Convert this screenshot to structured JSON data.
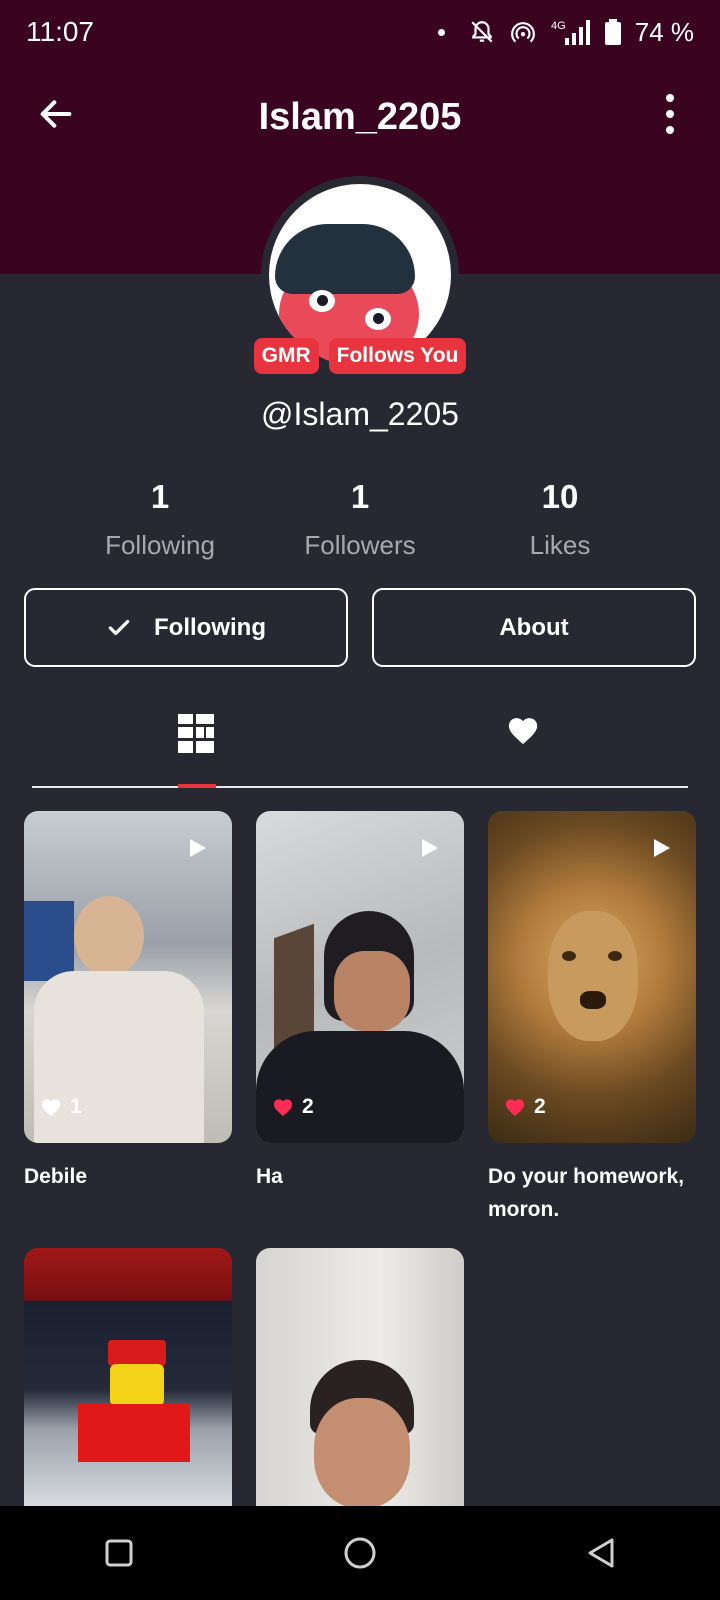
{
  "status_bar": {
    "time": "11:07",
    "battery": "74 %",
    "network": "4G"
  },
  "header": {
    "title": "Islam_2205"
  },
  "profile": {
    "badges": [
      "GMR",
      "Follows You"
    ],
    "handle": "@Islam_2205",
    "stats": [
      {
        "value": "1",
        "label": "Following"
      },
      {
        "value": "1",
        "label": "Followers"
      },
      {
        "value": "10",
        "label": "Likes"
      }
    ]
  },
  "actions": {
    "following_label": "Following",
    "about_label": "About"
  },
  "tabs": {
    "active": "videos",
    "icons": [
      "grid-icon",
      "heart-icon"
    ]
  },
  "videos": [
    {
      "caption": "Debile",
      "likes": "1",
      "liked": false
    },
    {
      "caption": "Ha",
      "likes": "2",
      "liked": true
    },
    {
      "caption": "Do your homework, moron.",
      "likes": "2",
      "liked": true
    },
    {
      "caption": "",
      "likes": "",
      "liked": false
    },
    {
      "caption": "",
      "likes": "",
      "liked": false
    }
  ],
  "colors": {
    "header": "#3a0320",
    "background": "#272832",
    "accent": "#e8343f",
    "like": "#ff2d55"
  }
}
